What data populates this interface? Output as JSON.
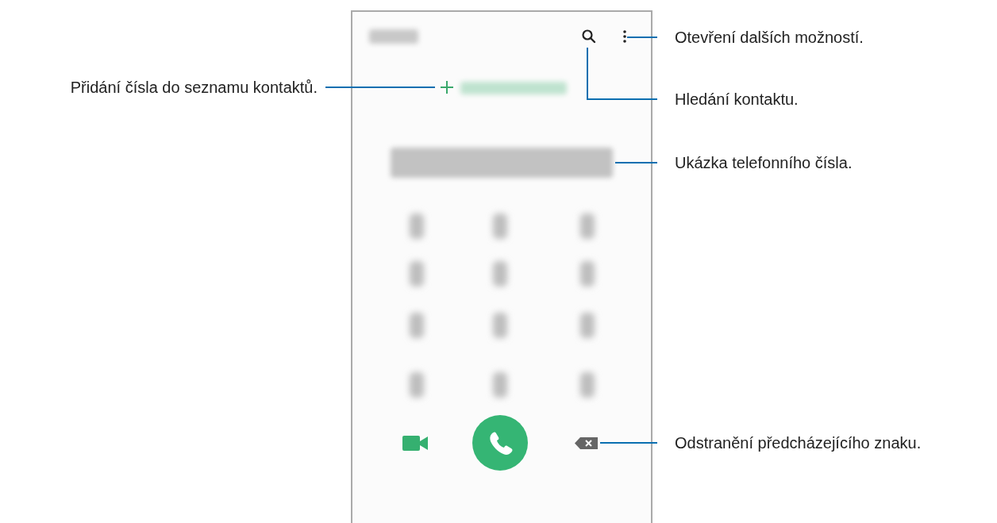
{
  "callouts": [
    {
      "text": "Otevření dalších možností."
    },
    {
      "text": "Přidání čísla do seznamu kontaktů."
    },
    {
      "text": "Hledání kontaktu."
    },
    {
      "text": "Ukázka telefonního čísla."
    },
    {
      "text": "Odstranění předcházejícího znaku."
    }
  ]
}
